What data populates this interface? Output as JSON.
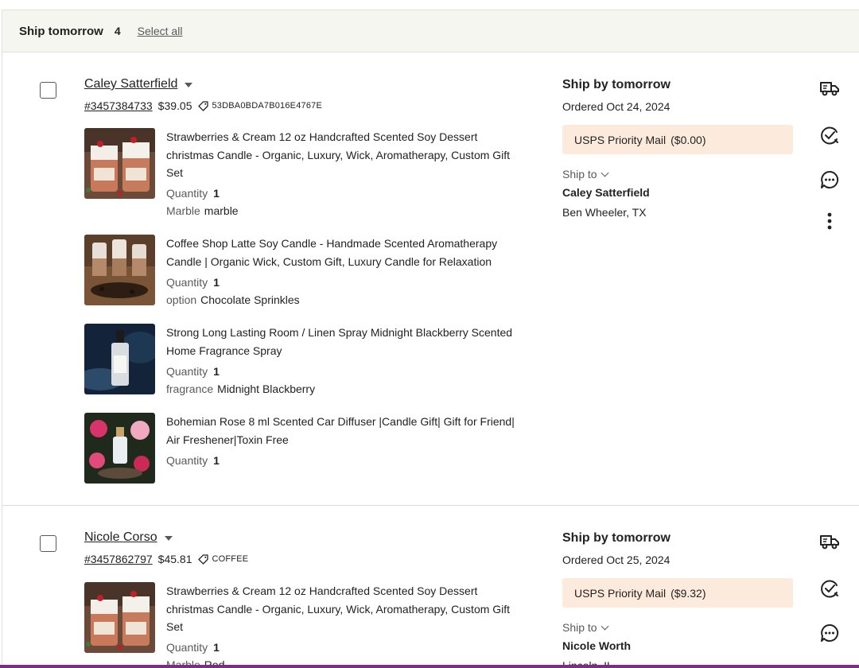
{
  "section": {
    "title": "Ship tomorrow",
    "count": "4",
    "select_all": "Select all"
  },
  "orders": [
    {
      "buyer": "Caley Satterfield",
      "order_number": "#3457384733",
      "total": "$39.05",
      "coupon": "53DBA0BDA7B016E4767E",
      "ship_by": "Ship by tomorrow",
      "ordered": "Ordered Oct 24, 2024",
      "shipping_method": "USPS Priority Mail",
      "shipping_price": "($0.00)",
      "ship_to_label": "Ship to",
      "recipient": "Caley Satterfield",
      "address": "Ben Wheeler, TX",
      "items": [
        {
          "title": "Strawberries & Cream 12 oz Handcrafted Scented Soy Dessert christmas Candle - Organic, Luxury, Wick, Aromatherapy, Custom Gift Set",
          "quantity_label": "Quantity",
          "quantity": "1",
          "variation_label": "Marble",
          "variation_value": "marble"
        },
        {
          "title": "Coffee Shop Latte Soy Candle - Handmade Scented Aromatherapy Candle | Organic Wick, Custom Gift, Luxury Candle for Relaxation",
          "quantity_label": "Quantity",
          "quantity": "1",
          "variation_label": "option",
          "variation_value": "Chocolate Sprinkles"
        },
        {
          "title": "Strong Long Lasting Room / Linen Spray Midnight Blackberry Scented Home Fragrance Spray",
          "quantity_label": "Quantity",
          "quantity": "1",
          "variation_label": "fragrance",
          "variation_value": "Midnight Blackberry"
        },
        {
          "title": "Bohemian Rose 8 ml Scented Car Diffuser |Candle Gift| Gift for Friend| Air Freshener|Toxin Free",
          "quantity_label": "Quantity",
          "quantity": "1"
        }
      ]
    },
    {
      "buyer": "Nicole Corso",
      "order_number": "#3457862797",
      "total": "$45.81",
      "coupon": "COFFEE",
      "ship_by": "Ship by tomorrow",
      "ordered": "Ordered Oct 25, 2024",
      "shipping_method": "USPS Priority Mail",
      "shipping_price": "($9.32)",
      "ship_to_label": "Ship to",
      "recipient": "Nicole Worth",
      "address": "Lincoln, IL",
      "items": [
        {
          "title": "Strawberries & Cream 12 oz Handcrafted Scented Soy Dessert christmas Candle - Organic, Luxury, Wick, Aromatherapy, Custom Gift Set",
          "quantity_label": "Quantity",
          "quantity": "1",
          "variation_label": "Marble",
          "variation_value": "Red"
        }
      ]
    }
  ],
  "icons": {
    "ship": "delivery-truck-icon",
    "complete": "check-circle-icon",
    "message": "message-bubble-icon",
    "more": "more-vertical-icon",
    "coupon": "tag-icon"
  },
  "colors": {
    "header_bg": "#f5f6ef",
    "shipping_pill_bg": "#fcebdc",
    "text": "#222222",
    "muted": "#595959",
    "bottom_bar": "#7a2f80"
  }
}
